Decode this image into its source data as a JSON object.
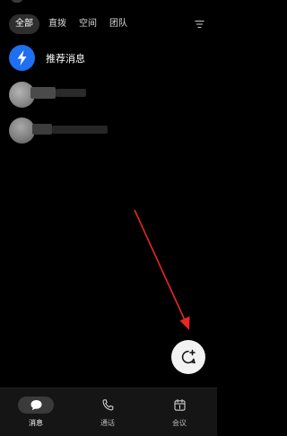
{
  "tabs": [
    {
      "label": "全部",
      "active": true
    },
    {
      "label": "直拨",
      "active": false
    },
    {
      "label": "空间",
      "active": false
    },
    {
      "label": "团队",
      "active": false
    }
  ],
  "filter_icon": "filter-lines-icon",
  "conversations": [
    {
      "title": "推荐消息",
      "avatar_icon": "lightning-bolt-icon",
      "avatar_color": "#1f6ff0"
    },
    {
      "title": "",
      "avatar_icon": "blurred-avatar",
      "blurred": true
    },
    {
      "title": "",
      "avatar_icon": "blurred-avatar",
      "blurred": true
    }
  ],
  "fab": {
    "icon": "new-chat-bubble-plus-icon"
  },
  "annotation": {
    "icon": "red-arrow",
    "color": "#e8271f"
  },
  "bottom_nav": [
    {
      "label": "消息",
      "icon": "message-bubble-icon",
      "active": true
    },
    {
      "label": "通话",
      "icon": "phone-icon",
      "active": false
    },
    {
      "label": "会议",
      "icon": "calendar-icon",
      "active": false
    }
  ]
}
